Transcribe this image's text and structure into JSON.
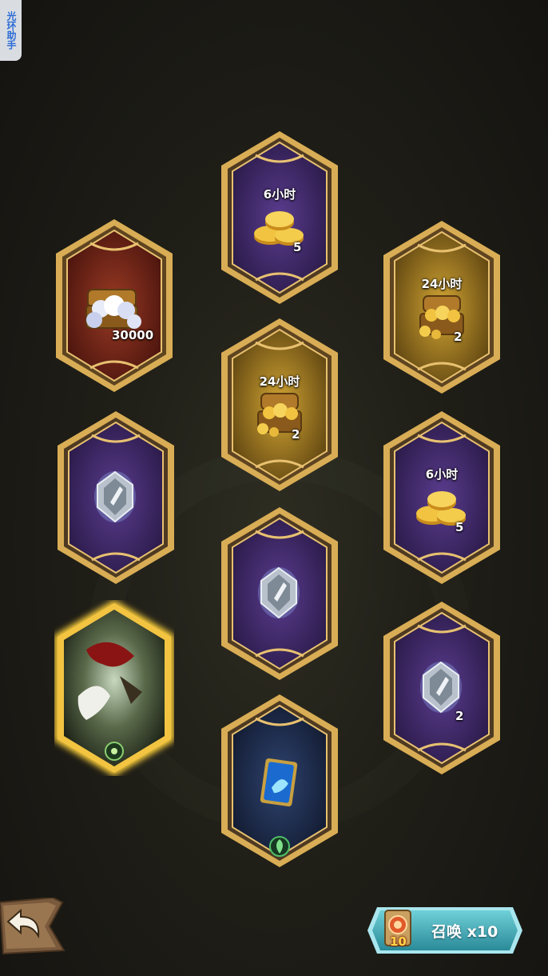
{
  "assistant_tab": {
    "label": "光环助手"
  },
  "cards": [
    {
      "id": "c1",
      "top_label": "",
      "qty": "30000",
      "reward": "diamond-chest",
      "theme": "red"
    },
    {
      "id": "c2",
      "top_label": "6小时",
      "qty": "5",
      "reward": "gold-coins",
      "theme": "purple"
    },
    {
      "id": "c3",
      "top_label": "24小时",
      "qty": "2",
      "reward": "gold-chest",
      "theme": "gold"
    },
    {
      "id": "c4",
      "top_label": "24小时",
      "qty": "2",
      "reward": "gold-chest",
      "theme": "gold"
    },
    {
      "id": "c5",
      "top_label": "",
      "qty": "",
      "reward": "silver-emblem",
      "theme": "purple"
    },
    {
      "id": "c6",
      "top_label": "6小时",
      "qty": "5",
      "reward": "gold-coins",
      "theme": "purple"
    },
    {
      "id": "c7",
      "top_label": "",
      "qty": "",
      "reward": "silver-emblem",
      "theme": "purple"
    },
    {
      "id": "c8",
      "top_label": "",
      "qty": "",
      "reward": "hero-portrait",
      "theme": "highlight"
    },
    {
      "id": "c9",
      "top_label": "",
      "qty": "2",
      "reward": "silver-emblem",
      "theme": "purple"
    },
    {
      "id": "c10",
      "top_label": "",
      "qty": "",
      "reward": "hero-card",
      "theme": "blue"
    }
  ],
  "summon_button": {
    "label": "召唤 x10",
    "ticket_count": "10"
  },
  "colors": {
    "gold_frame": "#e3b860",
    "purple_bg": "#3a2560",
    "red_bg": "#6a2318",
    "gold_bg": "#a07a1c",
    "blue_bg": "#1c2a50",
    "summon_teal": "#3fa6b2"
  }
}
